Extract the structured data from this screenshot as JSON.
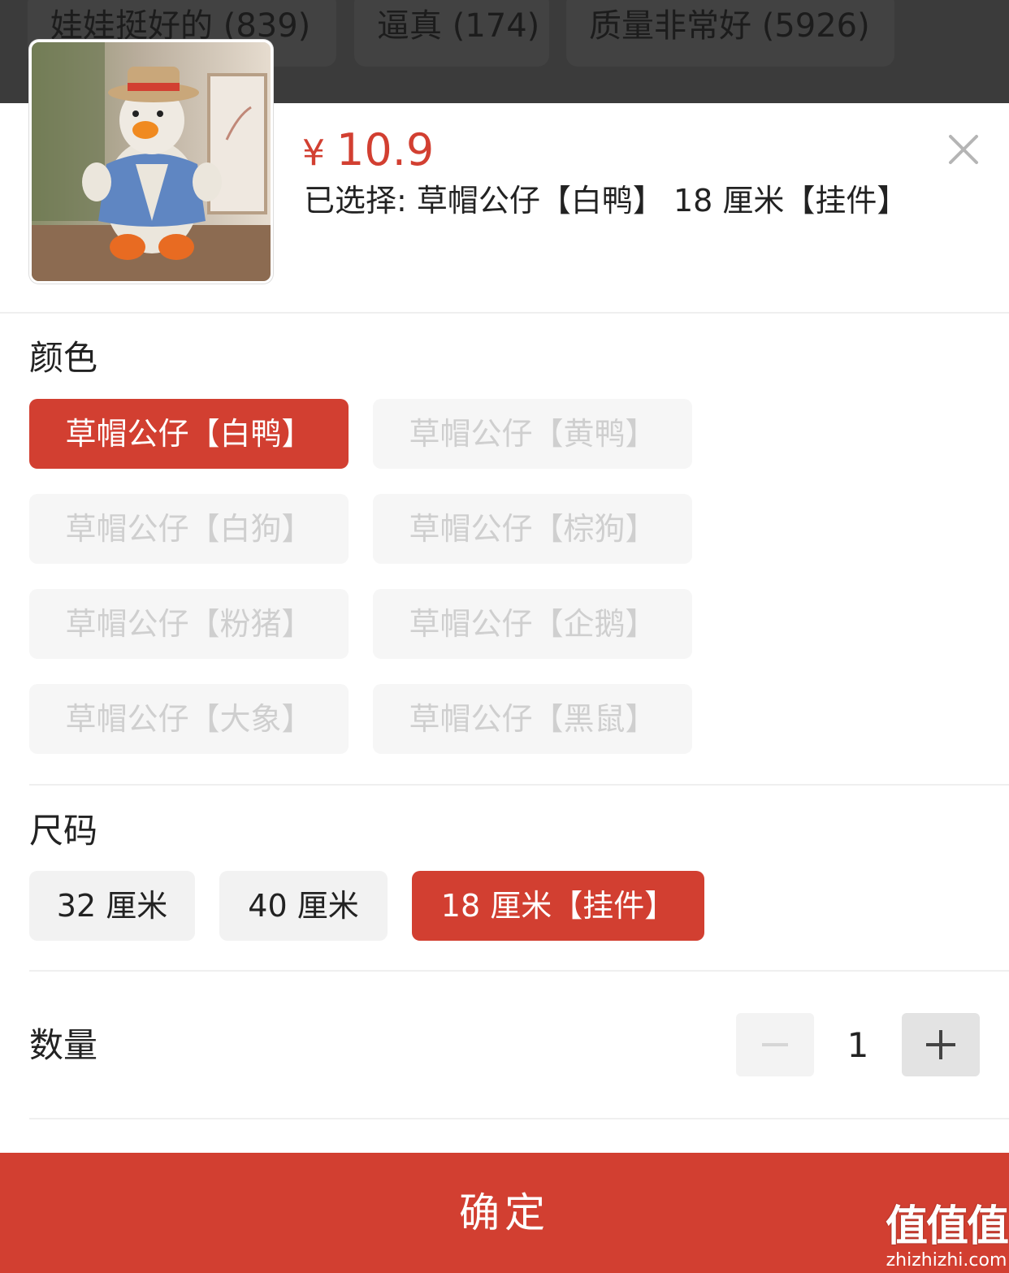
{
  "background_tags": [
    {
      "label": "娃娃挺好的 (839)"
    },
    {
      "label": "逼真 (174)"
    },
    {
      "label": "质量非常好 (5926)"
    }
  ],
  "product": {
    "currency": "¥",
    "price": "10.9",
    "selected_text": "已选择: 草帽公仔【白鸭】 18 厘米【挂件】",
    "image_icon": "plush-duck-straw-hat"
  },
  "color_section": {
    "title": "颜色",
    "options": [
      {
        "label": "草帽公仔【白鸭】",
        "state": "selected"
      },
      {
        "label": "草帽公仔【黄鸭】",
        "state": "disabled"
      },
      {
        "label": "草帽公仔【白狗】",
        "state": "disabled"
      },
      {
        "label": "草帽公仔【棕狗】",
        "state": "disabled"
      },
      {
        "label": "草帽公仔【粉猪】",
        "state": "disabled"
      },
      {
        "label": "草帽公仔【企鹅】",
        "state": "disabled"
      },
      {
        "label": "草帽公仔【大象】",
        "state": "disabled"
      },
      {
        "label": "草帽公仔【黑鼠】",
        "state": "disabled"
      }
    ]
  },
  "size_section": {
    "title": "尺码",
    "options": [
      {
        "label": "32 厘米",
        "state": "normal"
      },
      {
        "label": "40 厘米",
        "state": "normal"
      },
      {
        "label": "18 厘米【挂件】",
        "state": "selected"
      }
    ]
  },
  "quantity": {
    "title": "数量",
    "value": "1",
    "minus_icon": "minus-icon",
    "plus_icon": "plus-icon"
  },
  "confirm_label": "确定",
  "watermark": {
    "main": "值值值",
    "sub": "zhizhizhi.com"
  },
  "colors": {
    "accent": "#d23f31",
    "disabled_text": "#cfcfcf",
    "backdrop": "#3b3b3b"
  }
}
